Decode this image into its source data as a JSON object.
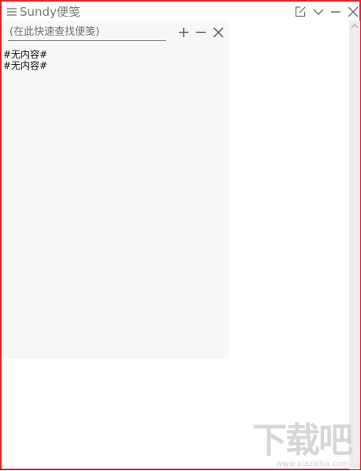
{
  "window": {
    "title": "Sundy便笺",
    "border_color": "#e81c1c",
    "icons": {
      "menu": "menu-icon",
      "new_note": "edit-note-icon",
      "collapse": "chevron-down-icon",
      "minimize": "minimize-icon",
      "close": "close-icon"
    }
  },
  "panel": {
    "search": {
      "placeholder": "(在此快速查找便笺)",
      "value": ""
    },
    "buttons": {
      "add": "plus-icon",
      "remove": "minus-icon",
      "close": "close-icon"
    },
    "notes": [
      {
        "text": "#无内容#"
      },
      {
        "text": "#无内容#"
      }
    ]
  },
  "watermark": {
    "logo_text": "下载吧",
    "url": "www.xiazaiba.com"
  }
}
